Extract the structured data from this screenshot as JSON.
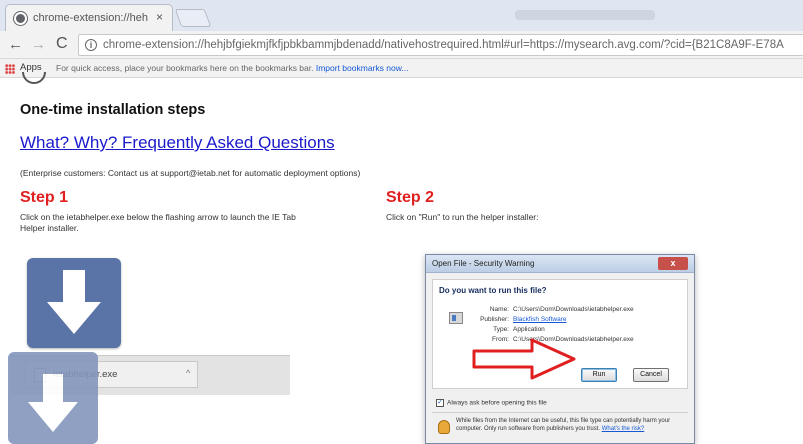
{
  "browser": {
    "tab": {
      "title": "chrome-extension://hehi",
      "close": "×"
    },
    "toolbar": {
      "back": "←",
      "forward": "→",
      "reload": "C",
      "url": "chrome-extension://hehjbfgiekmjfkfjpbkbammjbdenadd/nativehostrequired.html#url=https://mysearch.avg.com/?cid={B21C8A9F-E78A"
    },
    "bookmarks": {
      "apps_label": "Apps",
      "hint": "For quick access, place your bookmarks here on the bookmarks bar.",
      "import_link": "Import bookmarks now..."
    }
  },
  "page": {
    "heading": "One-time installation steps",
    "faq_link": "What? Why? Frequently Asked Questions",
    "enterprise_note": "(Enterprise customers: Contact us at support@ietab.net for automatic deployment options)",
    "step1": {
      "title": "Step 1",
      "description": "Click on the ietabhelper.exe below the flashing arrow to launch the IE Tab Helper installer."
    },
    "step2": {
      "title": "Step 2",
      "description": "Click on \"Run\" to run the helper installer:"
    },
    "download": {
      "file_name": "ietabhelper.exe",
      "chevron": "^"
    },
    "dialog": {
      "title": "Open File - Security Warning",
      "close": "x",
      "question": "Do you want to run this file?",
      "name_key": "Name:",
      "name_value": "C:\\Users\\Dom\\Downloads\\ietabhelper.exe",
      "publisher_key": "Publisher:",
      "publisher_value": "Blackfish Software",
      "type_key": "Type:",
      "type_value": "Application",
      "from_key": "From:",
      "from_value": "C:\\Users\\Dom\\Downloads\\ietabhelper.exe",
      "run_label": "Run",
      "cancel_label": "Cancel",
      "checkbox_label": "Always ask before opening this file",
      "checkbox_mark": "✓",
      "warning_text": "While files from the Internet can be useful, this file type can potentially harm your computer. Only run software from publishers you trust.",
      "warning_link": "What's the risk?"
    }
  },
  "colors": {
    "step_red": "#e02020",
    "link_blue": "#1a1acc",
    "tile_blue": "#5b74a8",
    "arrow_red": "#e02020"
  }
}
